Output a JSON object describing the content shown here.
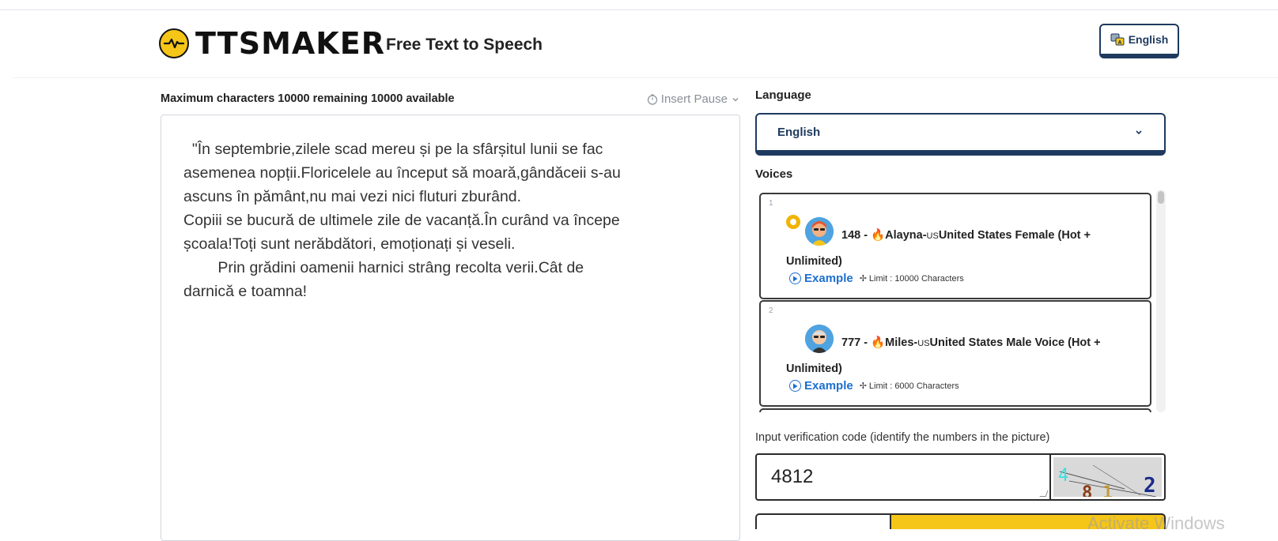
{
  "header": {
    "logo_text": "TTSMAKER",
    "tagline": "Free Text to Speech",
    "language_button": "English"
  },
  "editor": {
    "max_chars_text": "Maximum characters 10000 remaining 10000 available",
    "insert_pause_label": "Insert Pause",
    "text": "  \"În septembrie,zilele scad mereu și pe la sfârșitul lunii se fac\nasemenea nopții.Floricelele au început să moară,gândăceii s-au\nascuns în pământ,nu mai vezi nici fluturi zburând.\nCopiii se bucură de ultimele zile de vacanță.În curând va începe\nșcoala!Toți sunt nerăbdători, emoționați și veseli.\n        Prin grădini oamenii harnici strâng recolta verii.Cât de\ndarnică e toamna!"
  },
  "language": {
    "label": "Language",
    "selected": "English"
  },
  "voices": {
    "label": "Voices",
    "items": [
      {
        "num": "1",
        "id": "148 - ",
        "name": "Alayna-",
        "country_code": "US",
        "desc": "United States Female (Hot + Unlimited)",
        "example": "Example",
        "limit": "Limit : 10000 Characters",
        "selected": true
      },
      {
        "num": "2",
        "id": "777 - ",
        "name": "Miles-",
        "country_code": "US",
        "desc": "United States Male Voice (Hot + Unlimited)",
        "example": "Example",
        "limit": "Limit : 6000 Characters",
        "selected": false
      }
    ]
  },
  "verification": {
    "label": "Input verification code (identify the numbers in the picture)",
    "value": "4812",
    "captcha_digits": [
      "4",
      "8",
      "1",
      "2"
    ]
  },
  "watermark": "Activate Windows",
  "colors": {
    "accent_yellow": "#f5c518",
    "navy": "#1e3a5f",
    "link_blue": "#1d6fd1",
    "fire_orange": "#e85d04"
  }
}
